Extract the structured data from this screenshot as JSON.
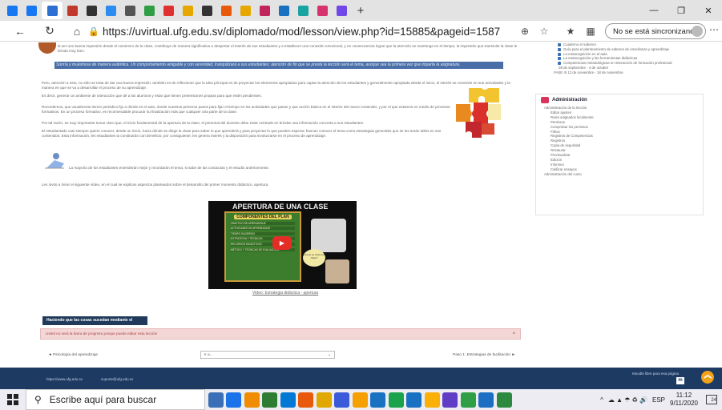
{
  "browser": {
    "tab_colors": [
      "#1877f2",
      "#1877f2",
      "#2c6fd1",
      "#c0392b",
      "#333333",
      "#2d8cf0",
      "#555555",
      "#2f9e44",
      "#e03131",
      "#e6a700",
      "#333333",
      "#e8590c",
      "#e6a700",
      "#c2255c",
      "#1971c2",
      "#1aa3a3",
      "#d6336c",
      "#7048e8"
    ],
    "new_tab": "+",
    "url": "https://uvirtual.ufg.edu.sv/diplomado/mod/lesson/view.php?id=15885&pageid=1587",
    "sync_label": "No se está sincronizando",
    "window_controls": [
      "—",
      "❐",
      "✕"
    ]
  },
  "lesson": {
    "para_top": "la ser uno buena impresión desde el comienzo de la clase, contribuye de manera significativa a despertar el interés de sus estudiantes y a establecer una conexión emocional, y en consecuencia lograr que la atención se mantenga en el tiempo, la impresión que transmite la clase le brinda muy bien.",
    "highlight_text": "Sonría y muéstrese de manera auténtica. Un comportamiento amigable y con serenidad, tranquilizará a sus estudiantes; atención de fin que se presta la lección será el tema, aunque sea la primera vez que imparta la asignatura.",
    "para_1": "Pero, atención a esto, no sólo se trata de dar una buena impresión: también es de reflexionar que la idea principal es de proyectar los elementos apropiados para captar la atención de los estudiantes y generalmente apropiada desde el inicio, el interés se convierte en sus actividades y la manera en que se va a desarrollar el proceso de su aprendizaje.",
    "para_2": "Es decir, generar un ambiente de interacción que dé a los alumnos y estar que tienen pretensiones propias para que estén pendientes.",
    "para_3": "Recordemos, que usualmente tienen periódico fijo a dónde es el aula, donde nuestros primeros pasos para fijar el tiempo en los actividades que pasan y que acción básica en el interior del nuevo contenido, y por el que estamos en medio de procesos formativos. En un proceso formativo, es recomendable procurar su finalización más que cualquier otra parte de la clase.",
    "para_4": "Por tal razón, es muy importante tomar claro que, el inicio fundamental de la apertura de la clase, el personal del docente debe estar centrado en brindar una información concreta a sus estudiantes.",
    "para_5": "El estudiantado casi siempre quiere conocer, desde un inicio, hacia dónde se dirige la clase para saber lo que aprenderá y para proyectar lo que pueden esperar; buscan conocer el tema como estrategias generales que se les serán útiles en sus contenidos. Esta información, les estudiantes la construirán con beneficio; por consiguiente, les genera interés y la disposición para involucrarse en el proceso de aprendizaje.",
    "reader_caption": "La mayoría de los estudiantes entenderán mejor y recordarán el tema, si sabe de las conductas y el estudio anteriormente.",
    "para_6": "Les invito a mirar el siguiente vídeo, en el cual se explican aspectos planteados sobre el desarrollo del primer momento didáctico, apertura.",
    "video": {
      "title": "APERTURA DE UNA CLASE",
      "board_title": "COMPONENTES DEL PLAN",
      "board_lines": [
        "OBJETIVO DE APRENDIZAJE",
        "ACTIVIDADES DE APRENDIZAJE",
        "TIEMPO SUGERIDO",
        "ESTRATEGIA Y TÉCNICAS",
        "RECURSOS DIDÁCTICOS",
        "MÉTODO Y TÉCNICAS DE EVALUACIÓN"
      ],
      "bubble": "¿Cómo se inicia una clase?",
      "link": "Video: Estrategia didáctica - apertura"
    },
    "action_button": "Haciendo que las cosas sucedan mediante el desarrollo",
    "alert_text": "Usted no verá la barra de progreso porque puede editar esta lección",
    "alert_close": "×",
    "prev_link": "◄ Psicología del aprendizaje",
    "jump_select": "Ir a...",
    "next_link": "Paso 1: Estrategias de facilitación ►"
  },
  "sidebar": {
    "top_items": [
      "Cuaderno el saberes",
      "Guía para el planteamiento de saberes de enseñanza y aprendizaje",
      "La metacognición en el aula",
      "La metacognición y las herramientas didácticas",
      "Competencias metodológicas en interacción de formación profesional",
      "08 de septiembre - 4 de octubre",
      "FASE III 12 de noviembre - 18 de noviembre"
    ],
    "admin_title": "Administración",
    "admin_items": [
      "Administración de la lección",
      "Editar ajustes",
      "Roles asignados localmente",
      "Permisos",
      "Comprobar los permisos",
      "Filtros",
      "Registros de Competencias",
      "Registros",
      "Copia de seguridad",
      "Restaurar",
      "Previsualizar",
      "Edición",
      "Informes",
      "Calificar ensayos",
      "Administración del curso"
    ]
  },
  "footer": {
    "link_1": "https://www.ufg.edu.sv",
    "link_2": "soporte@ufg.edu.sv",
    "moodle_label": "Moodle libre para esa página",
    "up_arrow": "❯"
  },
  "taskbar": {
    "search_placeholder": "Escribe aquí para buscar",
    "icon_colors": [
      "#3a6fb7",
      "#1a73e8",
      "#f08c00",
      "#2e7d32",
      "#0078d4",
      "#e8590c",
      "#e0a800",
      "#3b5bdb",
      "#f59f00",
      "#1971c2",
      "#1aa34a",
      "#1971c2",
      "#fab005",
      "#5f3dc4",
      "#2f9e44",
      "#1b6ec2",
      "#2b8a3e"
    ],
    "lang": "ESP",
    "time": "11:12",
    "date": "9/11/2020",
    "notif_count": "24"
  }
}
